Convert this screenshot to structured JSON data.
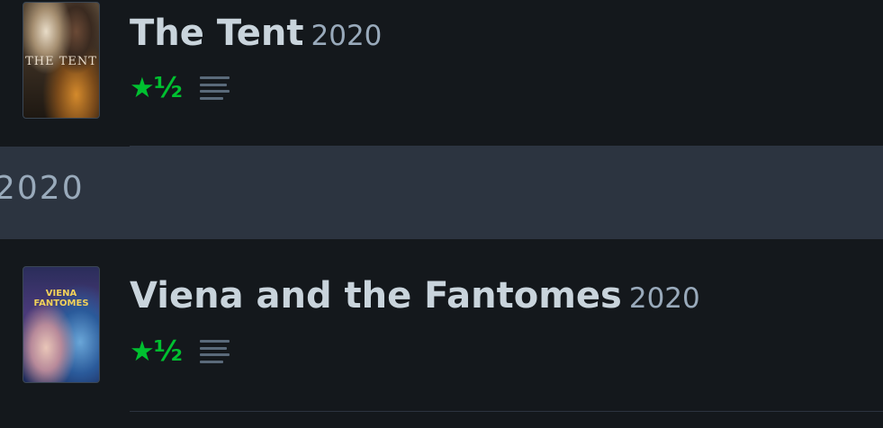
{
  "films": [
    {
      "title": "The Tent",
      "year": "2020",
      "rating": "★½",
      "poster": {
        "caption": "THE TENT",
        "icon": "poster-image-the-tent"
      },
      "review_icon": "review-text-icon"
    },
    {
      "title": "Viena and the Fantomes",
      "year": "2020",
      "rating": "★½",
      "poster": {
        "caption": "VIENA FANTOMES",
        "icon": "poster-image-viena"
      },
      "review_icon": "review-text-icon"
    }
  ],
  "year_header": {
    "label": "2020"
  },
  "colors": {
    "background": "#14181c",
    "header_band": "#2c3440",
    "star_green": "#00c030",
    "title_text": "#c9d4dc",
    "muted_text": "#99aabb"
  }
}
